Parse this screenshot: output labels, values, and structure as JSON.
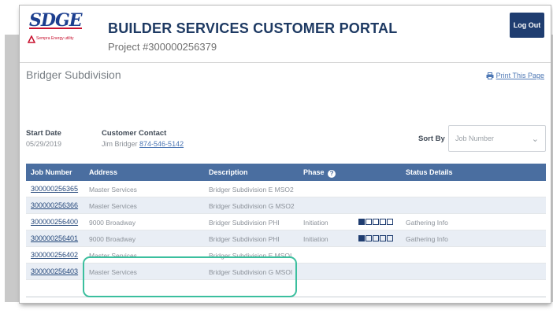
{
  "header": {
    "logo_text": "SDGE",
    "logo_sub": "Sempra Energy utility",
    "title": "BUILDER SERVICES CUSTOMER PORTAL",
    "project": "Project #300000256379",
    "logout_label": "Log Out"
  },
  "subdivision": {
    "name": "Bridger Subdivision",
    "print_label": "Print This Page"
  },
  "info": {
    "start_label": "Start Date",
    "start_value": "05/29/2019",
    "contact_label": "Customer Contact",
    "contact_name": "Jim Bridger",
    "contact_phone": "874-546-5142",
    "sort_label": "Sort By",
    "sort_value": "Job Number"
  },
  "table": {
    "columns": [
      "Job Number",
      "Address",
      "Description",
      "Phase",
      "Status Details"
    ],
    "rows": [
      {
        "job": "300000256365",
        "address": "Master Services",
        "description": "Bridger Subdivision E MSO2",
        "phase": "",
        "status": ""
      },
      {
        "job": "300000256366",
        "address": "Master Services",
        "description": "Bridger Subdivision G MSO2",
        "phase": "",
        "status": ""
      },
      {
        "job": "300000256400",
        "address": "9000 Broadway",
        "description": "Bridger Subdivision PHI",
        "phase": "Initiation",
        "progress_filled": 1,
        "progress_total": 5,
        "status": "Gathering Info"
      },
      {
        "job": "300000256401",
        "address": "9000 Broadway",
        "description": "Bridger Subdivision PHI",
        "phase": "Initiation",
        "progress_filled": 1,
        "progress_total": 5,
        "status": "Gathering Info"
      },
      {
        "job": "300000256402",
        "address": "Master Services",
        "description": "Bridger Subdivision E MSOI",
        "phase": "",
        "status": ""
      },
      {
        "job": "300000256403",
        "address": "Master Services",
        "description": "Bridger Subdivision G MSOI",
        "phase": "",
        "status": ""
      }
    ]
  },
  "colors": {
    "header_bar": "#4a6ea0",
    "brand_navy": "#1f3d70",
    "highlight": "#3bbf9e"
  }
}
